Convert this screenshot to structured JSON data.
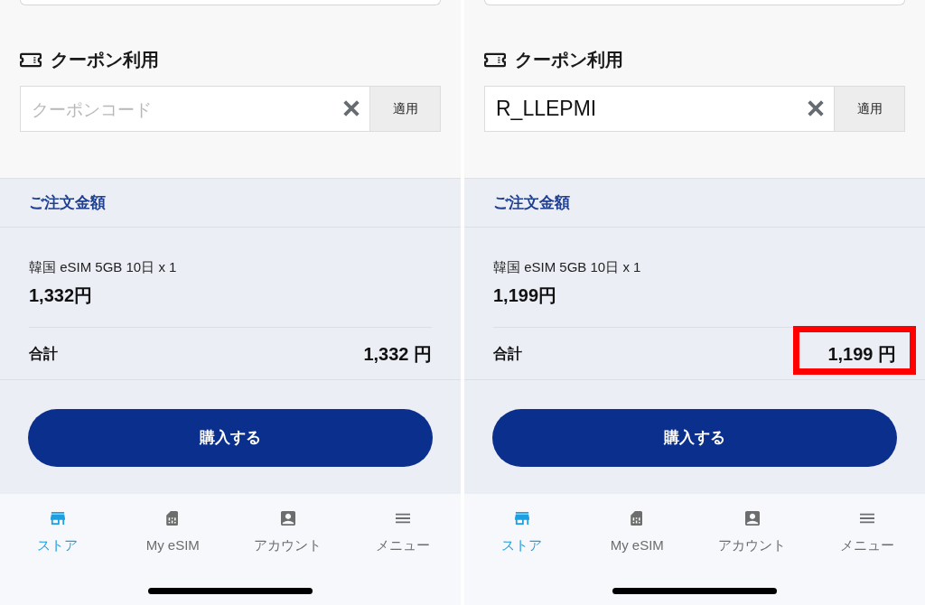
{
  "screens": [
    {
      "coupon": {
        "title": "クーポン利用",
        "field": {
          "placeholder": "クーポンコード"
        },
        "apply_button": "適用"
      },
      "order": {
        "title": "ご注文金額",
        "item": {
          "name": "韓国 eSIM 5GB 10日 x 1",
          "price": "1,332円"
        },
        "total": {
          "label": "合計",
          "amount": "1,332 円",
          "highlighted": false
        }
      },
      "purchase_button": "購入する",
      "tab_bar": [
        {
          "kind": "store",
          "label": "ストア",
          "selected": true
        },
        {
          "kind": "sim",
          "label": "My eSIM",
          "selected": false
        },
        {
          "kind": "account",
          "label": "アカウント",
          "selected": false
        },
        {
          "kind": "menu",
          "label": "メニュー",
          "selected": false
        }
      ]
    },
    {
      "coupon": {
        "title": "クーポン利用",
        "field": {
          "value": "R_LLEPMI"
        },
        "apply_button": "適用"
      },
      "order": {
        "title": "ご注文金額",
        "item": {
          "name": "韓国 eSIM 5GB 10日 x 1",
          "price": "1,199円"
        },
        "total": {
          "label": "合計",
          "amount": "1,199 円",
          "highlighted": true
        }
      },
      "purchase_button": "購入する",
      "tab_bar": [
        {
          "kind": "store",
          "label": "ストア",
          "selected": true
        },
        {
          "kind": "sim",
          "label": "My eSIM",
          "selected": false
        },
        {
          "kind": "account",
          "label": "アカウント",
          "selected": false
        },
        {
          "kind": "menu",
          "label": "メニュー",
          "selected": false
        }
      ]
    }
  ]
}
